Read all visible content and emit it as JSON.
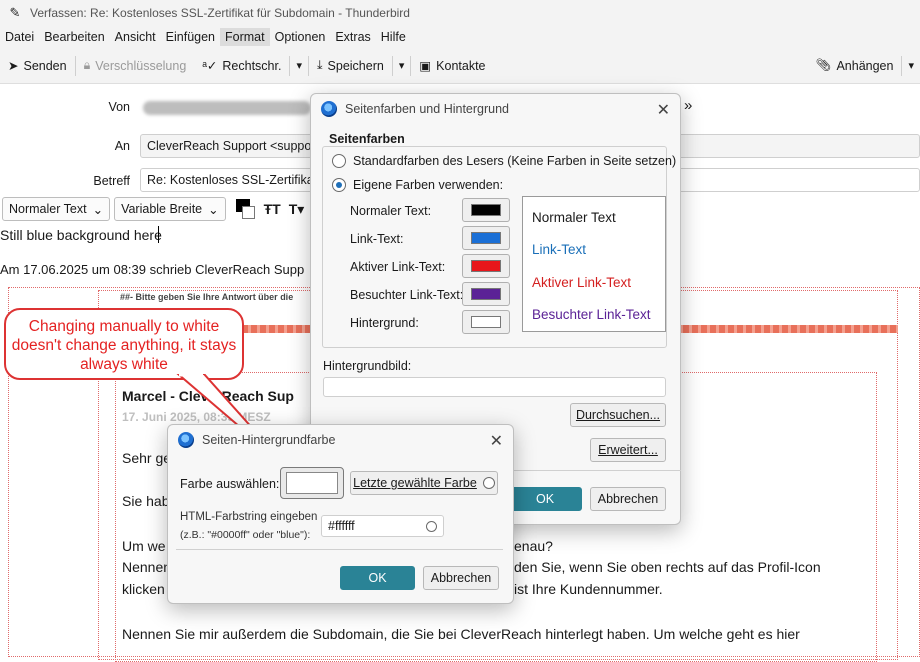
{
  "window": {
    "title": "Verfassen: Re: Kostenloses SSL-Zertifikat für Subdomain - Thunderbird"
  },
  "menu": [
    "Datei",
    "Bearbeiten",
    "Ansicht",
    "Einfügen",
    "Format",
    "Optionen",
    "Extras",
    "Hilfe"
  ],
  "toolbar": {
    "send": "Senden",
    "encrypt": "Verschlüsselung",
    "spelling": "Rechtschr.",
    "save": "Speichern",
    "contacts": "Kontakte",
    "attach": "Anhängen"
  },
  "header": {
    "from_label": "Von",
    "to_label": "An",
    "to_value": "CleverReach Support <support",
    "subject_label": "Betreff",
    "subject_value": "Re: Kostenloses SSL-Zertifikat fü"
  },
  "format": {
    "paragraph": "Normaler Text",
    "font": "Variable Breite"
  },
  "message": {
    "line1": "Still blue background here",
    "quote_header": "Am 17.06.2025 um 08:39 schrieb CleverReach Supp",
    "reply_hint": "##- Bitte geben Sie Ihre Antwort über die",
    "sender": "Marcel - CleverReach Sup",
    "date": "17. Juni 2025, 08:39 MESZ",
    "p1": "Sehr ge",
    "p2": "Sie hab",
    "p3a": "Um we",
    "p3b": "enau?",
    "p4a": "Nennen",
    "p4b": "den Sie, wenn Sie oben rechts auf das Profil-Icon",
    "p5a": "klicken",
    "p5b": "ist Ihre Kundennummer.",
    "p6": "Nennen Sie mir außerdem die Subdomain, die Sie bei CleverReach hinterlegt haben. Um welche geht es hier"
  },
  "callout": {
    "text": "Changing manually to white doesn't change anything, it stays always white"
  },
  "page_colors_dialog": {
    "title": "Seitenfarben und Hintergrund",
    "section": "Seitenfarben",
    "opt_default": "Standardfarben des Lesers (Keine Farben in Seite setzen)",
    "opt_custom": "Eigene Farben verwenden:",
    "rows": [
      {
        "label": "Normaler Text:",
        "color": "#000000"
      },
      {
        "label": "Link-Text:",
        "color": "#1a6fd6"
      },
      {
        "label": "Aktiver Link-Text:",
        "color": "#e8161b"
      },
      {
        "label": "Besuchter Link-Text:",
        "color": "#5b2296"
      },
      {
        "label": "Hintergrund:",
        "color": "#ffffff"
      }
    ],
    "preview": [
      {
        "text": "Normaler Text",
        "color": "#1a1a1a"
      },
      {
        "text": "Link-Text",
        "color": "#1a6fb8"
      },
      {
        "text": "Aktiver Link-Text",
        "color": "#d42020"
      },
      {
        "text": "Besuchter Link-Text",
        "color": "#5b2296"
      }
    ],
    "bg_image_label": "Hintergrundbild:",
    "browse": "Durchsuchen...",
    "advanced": "Erweitert...",
    "ok": "OK",
    "cancel": "Abbrechen"
  },
  "bg_color_dialog": {
    "title": "Seiten-Hintergrundfarbe",
    "choose_label": "Farbe auswählen:",
    "last_color": "Letzte gewählte Farbe",
    "html_label": "HTML-Farbstring eingeben",
    "html_hint": "(z.B.: \"#0000ff\" oder \"blue\"):",
    "html_value": "#ffffff",
    "ok": "OK",
    "cancel": "Abbrechen"
  },
  "colors": {
    "accent": "#2a8396",
    "callout": "#e42222"
  }
}
